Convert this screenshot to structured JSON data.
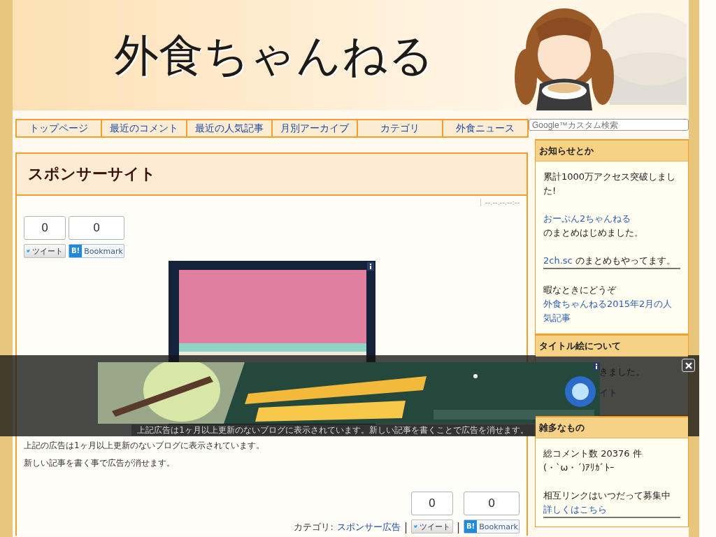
{
  "header": {
    "title": "外食ちゃんねる"
  },
  "nav": {
    "items": [
      {
        "label": "トップページ"
      },
      {
        "label": "最近のコメント"
      },
      {
        "label": "最近の人気記事"
      },
      {
        "label": "月別アーカイブ"
      },
      {
        "label": "カテゴリ"
      },
      {
        "label": "外食ニュース"
      }
    ],
    "search": {
      "placeholder": "Google™カスタム検索"
    }
  },
  "article": {
    "title": "スポンサーサイト",
    "date": "--.--.--.--:--",
    "share_top": [
      {
        "kind": "tweet",
        "count": "0",
        "label": "ツイート"
      },
      {
        "kind": "bookmark",
        "count": "0",
        "badge": "B!",
        "label": "Bookmark"
      }
    ],
    "ad_caption": "上記広告は1ヶ月以上更新のないブログに表示されています。新しい記事を書くことで広告を消せます。",
    "notes": [
      "上記の広告は1ヶ月以上更新のないブログに表示されています。",
      "新しい記事を書く事で広告が消せます。"
    ],
    "category_label": "カテゴリ:",
    "category": "スポンサー広告",
    "separator": "|",
    "separator_2": "|",
    "share_bottom": [
      {
        "kind": "tweet",
        "count": "0",
        "label": "ツイート"
      },
      {
        "kind": "bookmark",
        "count": "0",
        "badge": "B!",
        "label": "Bookmark"
      }
    ]
  },
  "sidebar": {
    "sections": [
      {
        "title": "お知らせとか",
        "blocks": [
          {
            "kind": "plain",
            "lines": [
              [
                {
                  "text": "累計1000万アクセス突破しました!",
                  "link": false
                }
              ]
            ]
          },
          {
            "kind": "plain",
            "lines": [
              [
                {
                  "text": "おーぷん2ちゃんねる",
                  "link": true
                }
              ],
              [
                {
                  "text": "のまとめはじめました。",
                  "link": false
                }
              ]
            ]
          },
          {
            "kind": "ruled",
            "lines": [
              [
                {
                  "text": "2ch.sc",
                  "link": true
                },
                {
                  "text": " のまとめもやってます。",
                  "link": false
                }
              ]
            ]
          },
          {
            "kind": "plain",
            "lines": [
              [
                {
                  "text": "暇なときにどうぞ",
                  "link": false
                }
              ],
              [
                {
                  "text": "外食ちゃんねる2015年2月の人気記事",
                  "link": true
                }
              ]
            ]
          }
        ]
      },
      {
        "title": "タイトル絵について",
        "blocks": [
          {
            "kind": "covered",
            "lines": [
              [
                {
                  "text": "きました。",
                  "link": false
                }
              ]
            ]
          },
          {
            "kind": "covered",
            "lines": [
              [
                {
                  "text": "イト",
                  "link": true
                }
              ]
            ]
          }
        ]
      },
      {
        "title": "雑多なもの",
        "blocks": [
          {
            "kind": "plain",
            "lines": [
              [
                {
                  "text": "総コメント数 20376 件",
                  "link": false
                }
              ],
              [
                {
                  "text": "(・`ω・´)ｱﾘｶﾞﾄｰ",
                  "link": false
                }
              ]
            ]
          },
          {
            "kind": "ruled",
            "lines": [
              [
                {
                  "text": "相互リンクはいつだって募集中",
                  "link": false
                }
              ],
              [
                {
                  "text": "詳しくはこちら",
                  "link": true
                }
              ]
            ]
          }
        ]
      }
    ]
  }
}
